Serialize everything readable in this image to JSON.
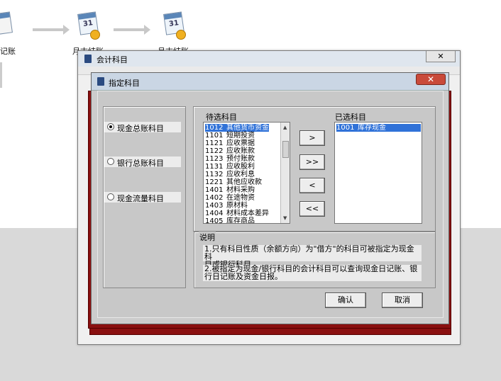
{
  "flow": {
    "item1_label": "记账",
    "item2_label": "月末结账",
    "item3_label": "月末结账",
    "cal_day": "31"
  },
  "outer_window": {
    "title": "会计科目",
    "close_symbol": "✕"
  },
  "dialog": {
    "title": "指定科目",
    "close_symbol": "✕",
    "radios": [
      {
        "label": "现金总账科目",
        "checked": true
      },
      {
        "label": "银行总账科目",
        "checked": false
      },
      {
        "label": "现金流量科目",
        "checked": false
      }
    ],
    "pending_label": "待选科目",
    "selected_label": "已选科目",
    "pending_items": [
      {
        "code": "1012",
        "name": "其他货币资金"
      },
      {
        "code": "1101",
        "name": "短期投资"
      },
      {
        "code": "1121",
        "name": "应收票据"
      },
      {
        "code": "1122",
        "name": "应收账款"
      },
      {
        "code": "1123",
        "name": "预付账款"
      },
      {
        "code": "1131",
        "name": "应收股利"
      },
      {
        "code": "1132",
        "name": "应收利息"
      },
      {
        "code": "1221",
        "name": "其他应收款"
      },
      {
        "code": "1401",
        "name": "材料采购"
      },
      {
        "code": "1402",
        "name": "在途物资"
      },
      {
        "code": "1403",
        "name": "原材料"
      },
      {
        "code": "1404",
        "name": "材料成本差异"
      },
      {
        "code": "1405",
        "name": "库存商品"
      }
    ],
    "selected_items": [
      {
        "code": "1001",
        "name": "库存现金"
      }
    ],
    "move_buttons": [
      ">",
      ">>",
      "<",
      "<<"
    ],
    "note_label": "说明",
    "note_1": "1.只有科目性质（余额方向）为\"借方\"的科目可被指定为现金科\n目或银行科目。",
    "note_2": "2.被指定为现金/银行科目的会计科目可以查询现金日记账、银\n行日记账及资金日报。",
    "ok_label": "确认",
    "cancel_label": "取消"
  },
  "colors": {
    "selection": "#3072d8",
    "dialog_bg": "#cccccc",
    "stack_red": "#8a1010"
  }
}
